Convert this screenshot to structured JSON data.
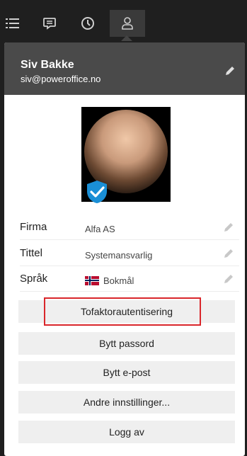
{
  "toolbar": {
    "items": [
      {
        "icon": "list-icon"
      },
      {
        "icon": "chat-icon"
      },
      {
        "icon": "clock-icon"
      },
      {
        "icon": "user-icon",
        "active": true
      }
    ]
  },
  "profile": {
    "name": "Siv Bakke",
    "email": "siv@poweroffice.no",
    "verified": true
  },
  "fields": [
    {
      "label": "Firma",
      "value": "Alfa AS"
    },
    {
      "label": "Tittel",
      "value": "Systemansvarlig"
    },
    {
      "label": "Språk",
      "value": "Bokmål",
      "flag": "norway-flag-icon"
    }
  ],
  "actions": [
    {
      "label": "Tofaktorautentisering",
      "highlighted": true
    },
    {
      "label": "Bytt passord"
    },
    {
      "label": "Bytt e-post"
    },
    {
      "label": "Andre innstillinger..."
    },
    {
      "label": "Logg av"
    }
  ],
  "colors": {
    "header_bg": "#4a4a4a",
    "toolbar_bg": "#1f1f1f",
    "button_bg": "#efefef",
    "highlight_border": "#d9262b",
    "badge": "#1a8fd6"
  }
}
